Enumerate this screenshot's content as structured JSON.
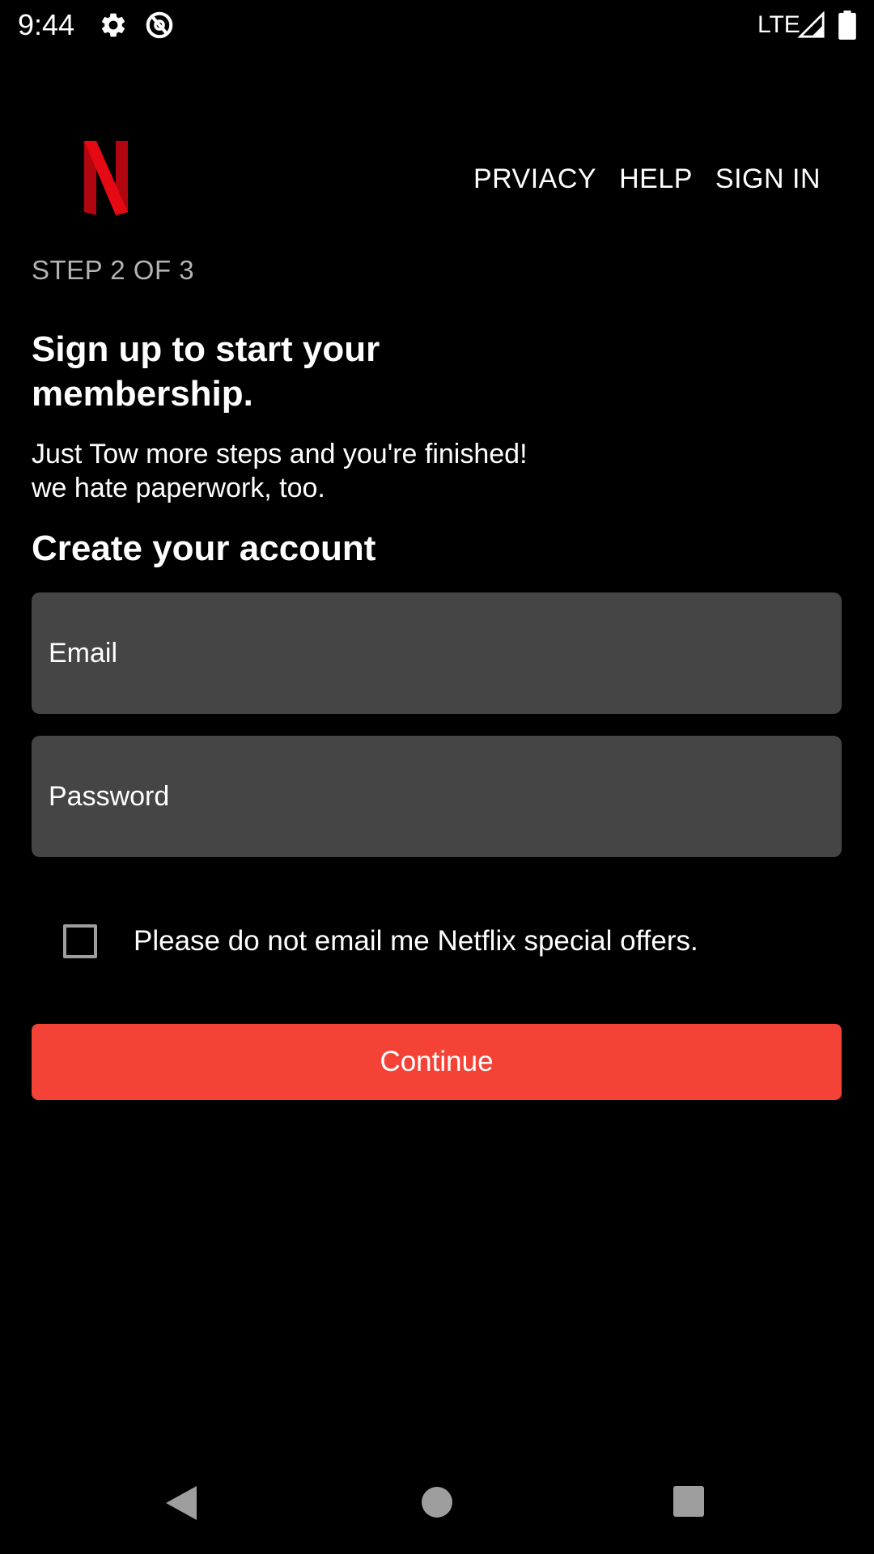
{
  "status_bar": {
    "time": "9:44",
    "network": "LTE",
    "icons": [
      "gear-icon",
      "data-saver-icon",
      "signal-icon",
      "battery-icon"
    ]
  },
  "header": {
    "logo": "N",
    "nav": [
      "PRVIACY",
      "HELP",
      "SIGN IN"
    ]
  },
  "main": {
    "step": "STEP 2 OF 3",
    "headline": "Sign up to start your membership.",
    "subtext_lines": [
      "Just Tow more steps and you're finished!",
      "we hate paperwork, too."
    ],
    "section_title": "Create your account",
    "email": {
      "placeholder": "Email",
      "value": ""
    },
    "password": {
      "placeholder": "Password",
      "value": ""
    },
    "checkbox": {
      "label": "Please do not email me Netflix special offers.",
      "checked": false
    },
    "continue_label": "Continue"
  },
  "nav_bar": {
    "buttons": [
      "back-icon",
      "home-icon",
      "recents-icon"
    ]
  },
  "colors": {
    "background": "#000000",
    "field_background": "#454545",
    "accent": "#f44336",
    "logo_red": "#e50914",
    "muted_text": "#b3b3b3"
  }
}
